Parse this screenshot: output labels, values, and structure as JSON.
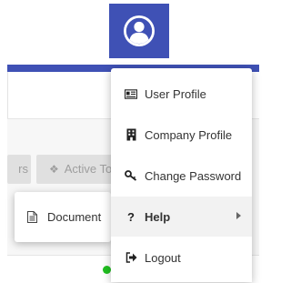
{
  "header": {
    "avatar_icon": "user-avatar-icon",
    "accent_color": "#3f51b5"
  },
  "background": {
    "tabs": [
      {
        "label": "rs"
      },
      {
        "label": "Active To",
        "icon": "tag-icon"
      }
    ],
    "status_color": "#20c020"
  },
  "menu": {
    "items": [
      {
        "label": "User Profile",
        "icon": "id-card-icon"
      },
      {
        "label": "Company Profile",
        "icon": "building-icon"
      },
      {
        "label": "Change Password",
        "icon": "key-icon"
      },
      {
        "label": "Help",
        "icon": "question-icon",
        "has_submenu": true,
        "highlighted": true
      },
      {
        "label": "Logout",
        "icon": "sign-out-icon"
      }
    ]
  },
  "help_submenu": {
    "items": [
      {
        "label": "Document",
        "icon": "document-icon"
      }
    ]
  }
}
